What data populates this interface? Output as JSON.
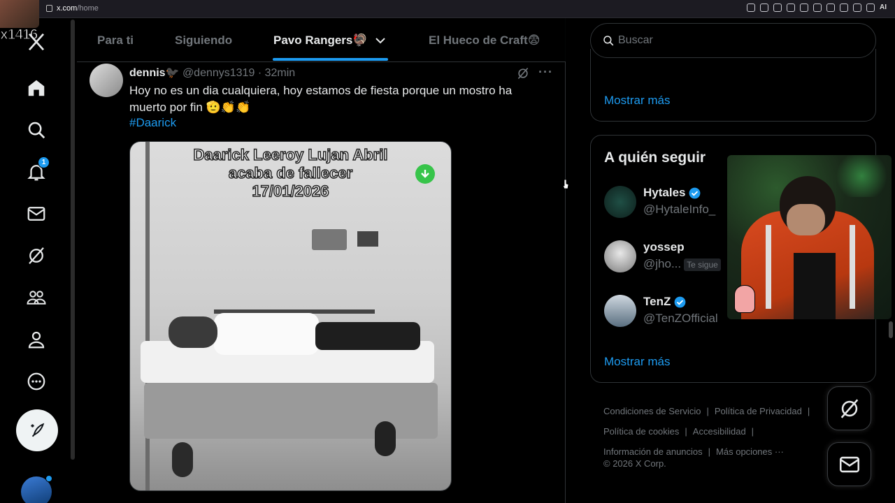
{
  "browser": {
    "url_host": "x.com",
    "url_path": "/home",
    "ai_label": "AI"
  },
  "stream": {
    "tag": "x1416"
  },
  "nav": {
    "notification_count": "1",
    "items": [
      "home",
      "explore",
      "notifications",
      "messages",
      "grok",
      "communities",
      "profile",
      "more"
    ]
  },
  "tabs": [
    {
      "label": "Para ti"
    },
    {
      "label": "Siguiendo"
    },
    {
      "label": "Pavo Rangers🦃"
    },
    {
      "label": "El Hueco de Craft😨"
    }
  ],
  "post": {
    "name": "dennis🐦‍⬛",
    "handle": "@dennys1319",
    "time": "32min",
    "meta_sep": "·",
    "text": "Hoy no es un dia cualquiera, hoy estamos de fiesta porque un mostro ha muerto por fin 🫡👏👏",
    "hashtag": "#Daarick",
    "media_caption_line1": "Daarick Leeroy Lujan Abril",
    "media_caption_line2": "acaba de fallecer",
    "media_caption_line3": "17/01/2026"
  },
  "search": {
    "placeholder": "Buscar"
  },
  "trends_card": {
    "show_more": "Mostrar más"
  },
  "who_to_follow": {
    "title": "A quién seguir",
    "accounts": [
      {
        "name": "Hytales",
        "handle": "@HytaleInfo_",
        "verified": true
      },
      {
        "name": "yossep",
        "handle": "@jho...",
        "follows_you": "Te sigue",
        "verified": false
      },
      {
        "name": "TenZ",
        "handle": "@TenZOfficial",
        "verified": true
      }
    ],
    "show_more": "Mostrar más"
  },
  "footer": {
    "links": [
      "Condiciones de Servicio",
      "Política de Privacidad",
      "Política de cookies",
      "Accesibilidad",
      "Información de anuncios",
      "Más opciones ···"
    ],
    "copyright": "© 2026 X Corp."
  },
  "colors": {
    "accent": "#1d9bf0",
    "background": "#000000",
    "border": "#2f3336",
    "muted": "#71767b",
    "text": "#e7e9ea"
  }
}
